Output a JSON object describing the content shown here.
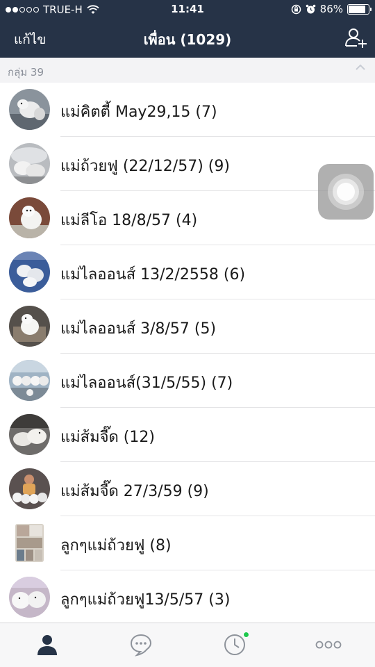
{
  "status_bar": {
    "carrier": "TRUE-H",
    "time": "11:41",
    "battery": "86%",
    "battery_level": 0.86,
    "signal_bars": 2
  },
  "navbar": {
    "edit_label": "แก้ไข",
    "title": "เพื่อน (1029)",
    "add_friend_icon": "add-friend-icon"
  },
  "group_header": {
    "label": "กลุ่ม 39",
    "collapse_icon": "chevron-up-icon"
  },
  "groups": [
    {
      "name": "แม่คิตตี้ May29,15  (7)",
      "avatar": "photo-white-dogs"
    },
    {
      "name": "แม่ถ้วยฟู (22/12/57)  (9)",
      "avatar": "photo-puppies"
    },
    {
      "name": "แม่ลีโอ 18/8/57  (4)",
      "avatar": "photo-white-dog"
    },
    {
      "name": "แม่ไลออนส์ 13/2/2558  (6)",
      "avatar": "photo-puppies-blanket"
    },
    {
      "name": "แม่ไลออนส์ 3/8/57  (5)",
      "avatar": "photo-dog-bed"
    },
    {
      "name": "แม่ไลออนส์(31/5/55)  (7)",
      "avatar": "photo-puppy-row"
    },
    {
      "name": "แม่ส้มจี๊ด  (12)",
      "avatar": "photo-puppies-sleeping"
    },
    {
      "name": "แม่ส้มจี๊ด 27/3/59  (9)",
      "avatar": "photo-woman-puppies"
    },
    {
      "name": "ลูกๆแม่ถ้วยฟู  (8)",
      "avatar": "photo-collage"
    },
    {
      "name": "ลูกๆแม่ถ้วยฟู13/5/57  (3)",
      "avatar": "photo-fluffy-puppies"
    }
  ],
  "tabbar": {
    "tabs": [
      "friends-icon",
      "chat-icon",
      "timeline-icon",
      "more-icon"
    ],
    "active_tab": "friends-icon",
    "timeline_badge_color": "#1ec84d"
  },
  "colors": {
    "header_bg": "#263347",
    "separator": "#e4e4e6",
    "group_header_bg": "#f3f3f5"
  }
}
